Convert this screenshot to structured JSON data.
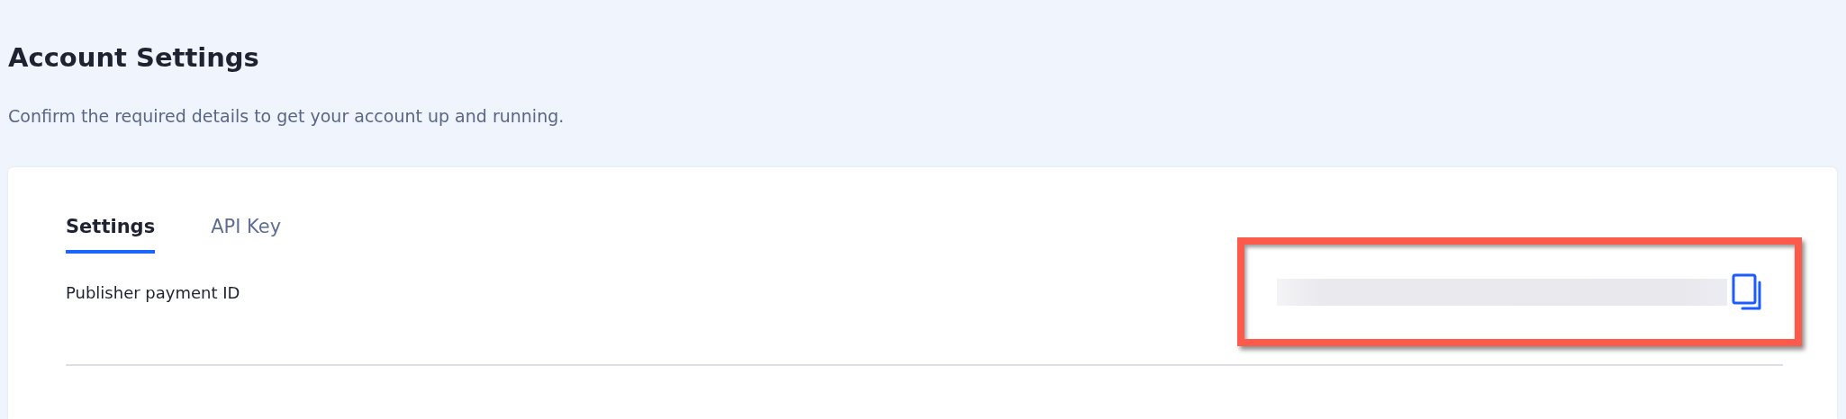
{
  "page": {
    "title": "Account Settings",
    "subtitle": "Confirm the required details to get your account up and running."
  },
  "tabs": [
    {
      "label": "Settings",
      "selected": true
    },
    {
      "label": "API Key",
      "selected": false
    }
  ],
  "fields": [
    {
      "label": "Publisher payment ID",
      "highlighted": true
    }
  ]
}
